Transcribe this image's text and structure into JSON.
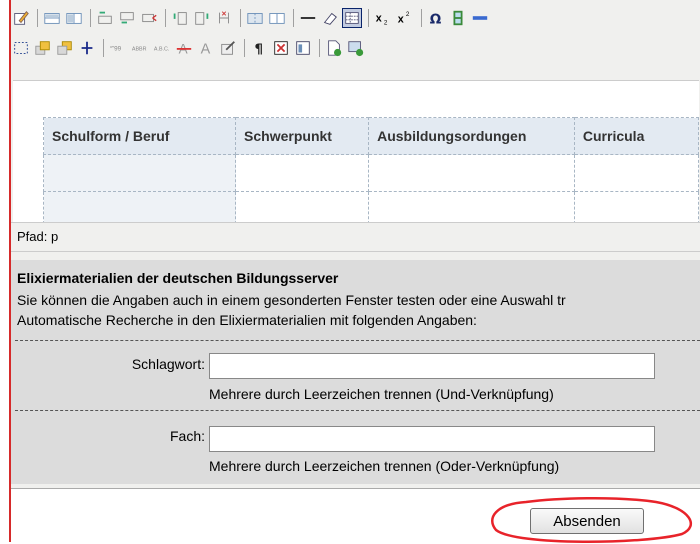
{
  "toolbar_row1": [
    {
      "icon": "edit-icon"
    },
    {
      "sep": true
    },
    {
      "icon": "table-row-icon"
    },
    {
      "icon": "table-col-icon"
    },
    {
      "sep": true
    },
    {
      "icon": "insert-row-before-icon"
    },
    {
      "icon": "insert-row-after-icon"
    },
    {
      "icon": "delete-row-icon"
    },
    {
      "sep": true
    },
    {
      "icon": "insert-col-before-icon"
    },
    {
      "icon": "insert-col-after-icon"
    },
    {
      "icon": "delete-col-icon"
    },
    {
      "sep": true
    },
    {
      "icon": "merge-cells-icon"
    },
    {
      "icon": "split-cells-icon"
    },
    {
      "sep": true
    },
    {
      "icon": "horizontal-rule-icon"
    },
    {
      "icon": "eraser-icon"
    },
    {
      "icon": "visual-aid-icon",
      "active": true
    },
    {
      "sep": true
    },
    {
      "icon": "subscript-icon"
    },
    {
      "icon": "superscript-icon"
    },
    {
      "sep": true
    },
    {
      "icon": "special-char-icon"
    },
    {
      "icon": "media-icon"
    },
    {
      "icon": "more-icon"
    }
  ],
  "toolbar_row2": [
    {
      "icon": "select-box-icon"
    },
    {
      "icon": "layer-forward-icon"
    },
    {
      "icon": "layer-backward-icon"
    },
    {
      "icon": "absolute-icon"
    },
    {
      "sep": true
    },
    {
      "icon": "cite-icon"
    },
    {
      "icon": "abbr-icon"
    },
    {
      "icon": "acronym-icon"
    },
    {
      "icon": "strikethrough-icon"
    },
    {
      "icon": "font-color-icon"
    },
    {
      "icon": "attributes-icon"
    },
    {
      "sep": true
    },
    {
      "icon": "pilcrow-icon"
    },
    {
      "icon": "nonbreaking-icon"
    },
    {
      "icon": "template-icon"
    },
    {
      "sep": true
    },
    {
      "icon": "new-document-icon"
    },
    {
      "icon": "insert-image-icon"
    }
  ],
  "table": {
    "headers": [
      "Schulform / Beruf",
      "Schwerpunkt",
      "Ausbildungsordungen",
      "Curricula"
    ]
  },
  "status": {
    "path": "Pfad: p"
  },
  "panel": {
    "title": "Elixiermaterialien der deutschen Bildungsserver",
    "line1": "Sie können die Angaben auch in einem gesonderten Fenster testen oder eine Auswahl tr",
    "line2": "Automatische Recherche in den Elixiermaterialien mit folgenden Angaben:",
    "schlagwort": {
      "label": "Schlagwort:",
      "value": "",
      "hint": "Mehrere durch Leerzeichen trennen (Und-Verknüpfung)"
    },
    "fach": {
      "label": "Fach:",
      "value": "",
      "hint": "Mehrere durch Leerzeichen trennen (Oder-Verknüpfung)"
    }
  },
  "submit": {
    "label": "Absenden"
  },
  "colors": {
    "accent_red": "#d62a2a",
    "panel_bg": "#dcdcdc",
    "header_cell": "#e3eaf2"
  }
}
